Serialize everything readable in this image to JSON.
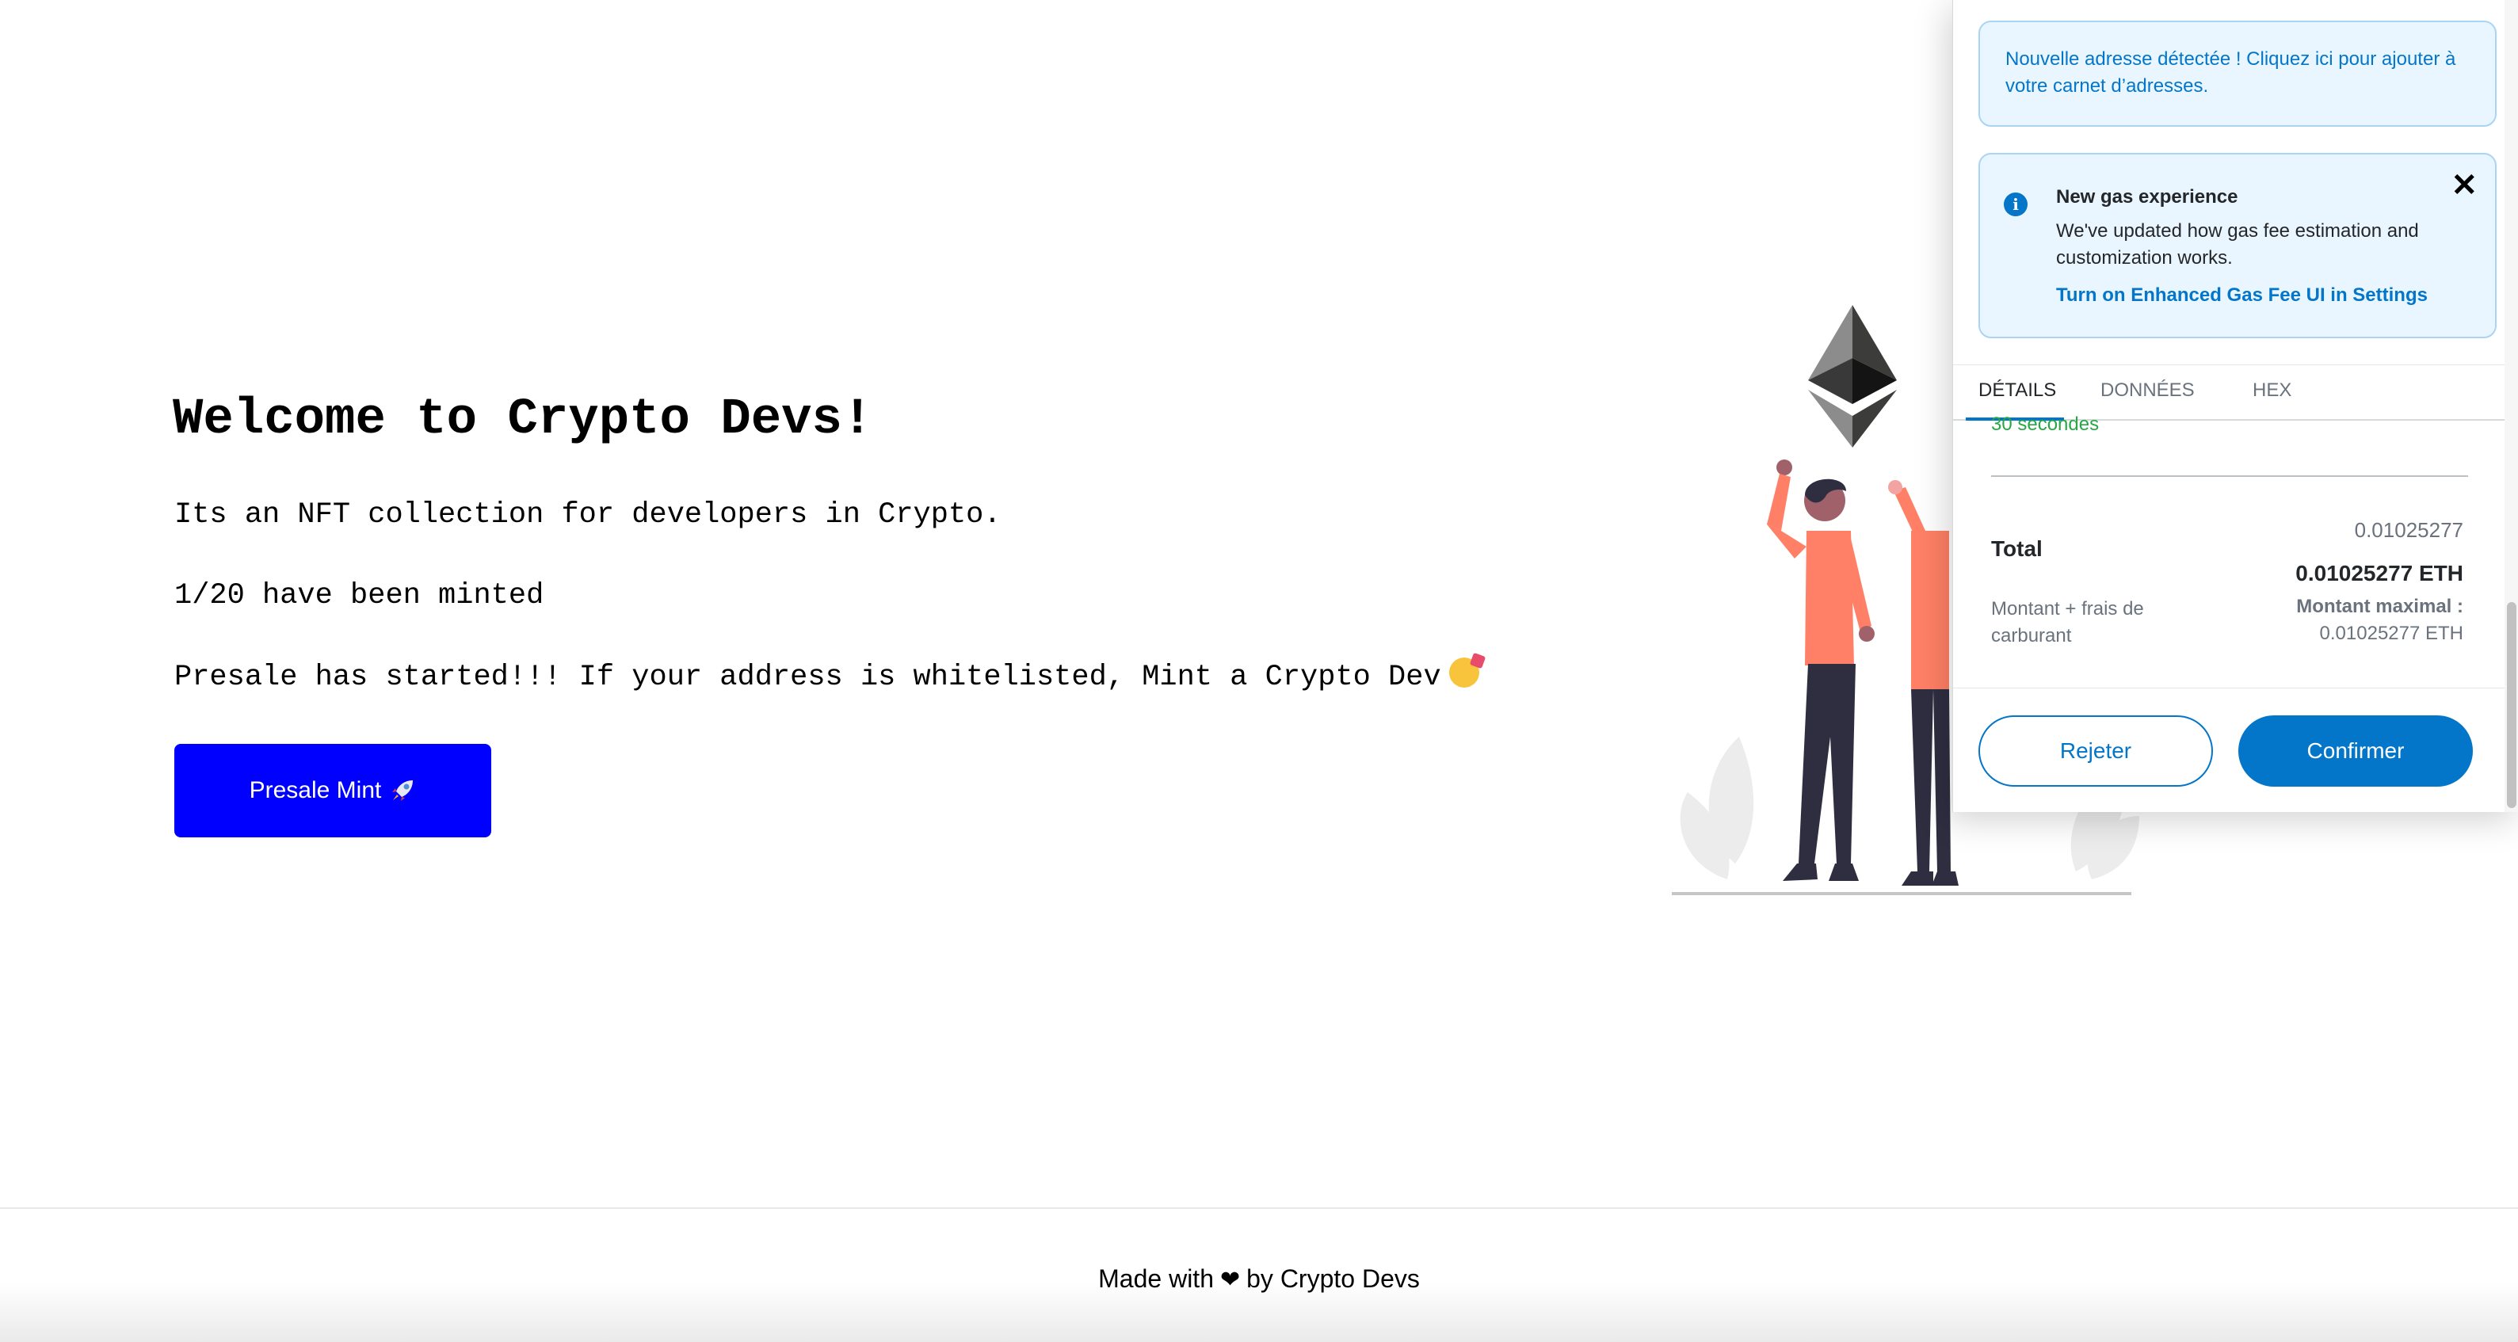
{
  "hero": {
    "title": "Welcome to Crypto Devs!",
    "description": "Its an NFT collection for developers in Crypto.",
    "minted": "1/20 have been minted",
    "presale": "Presale has started!!! If your address is whitelisted, Mint a Crypto Dev",
    "presale_emoji": "partying-face-icon",
    "mint_button_label": "Presale Mint",
    "mint_button_icon": "rocket-icon",
    "mint_button_color": "#0000ff"
  },
  "illustration": {
    "subject": "two people raising hands toward the Ethereum logo"
  },
  "footer": {
    "prefix": "Made with",
    "icon": "heart-icon",
    "suffix": "by Crypto Devs"
  },
  "wallet": {
    "accent_color": "#0376c9",
    "address_alert": "Nouvelle adresse détectée ! Cliquez ici pour ajouter à votre carnet d’adresses.",
    "gas_alert": {
      "title": "New gas experience",
      "body": "We've updated how gas fee estimation and customization works.",
      "link": "Turn on Enhanced Gas Fee UI in Settings"
    },
    "tabs": [
      {
        "label": "DÉTAILS",
        "active": true
      },
      {
        "label": "DONNÉES",
        "active": false
      },
      {
        "label": "HEX",
        "active": false
      }
    ],
    "time_estimate": "30 secondes",
    "total_label": "Total",
    "total_amount": "0.01025277",
    "total_amount_eth": "0.01025277 ETH",
    "fees_label": "Montant + frais de carburant",
    "max_label": "Montant maximal :",
    "max_value": "0.01025277 ETH",
    "reject_label": "Rejeter",
    "confirm_label": "Confirmer"
  }
}
